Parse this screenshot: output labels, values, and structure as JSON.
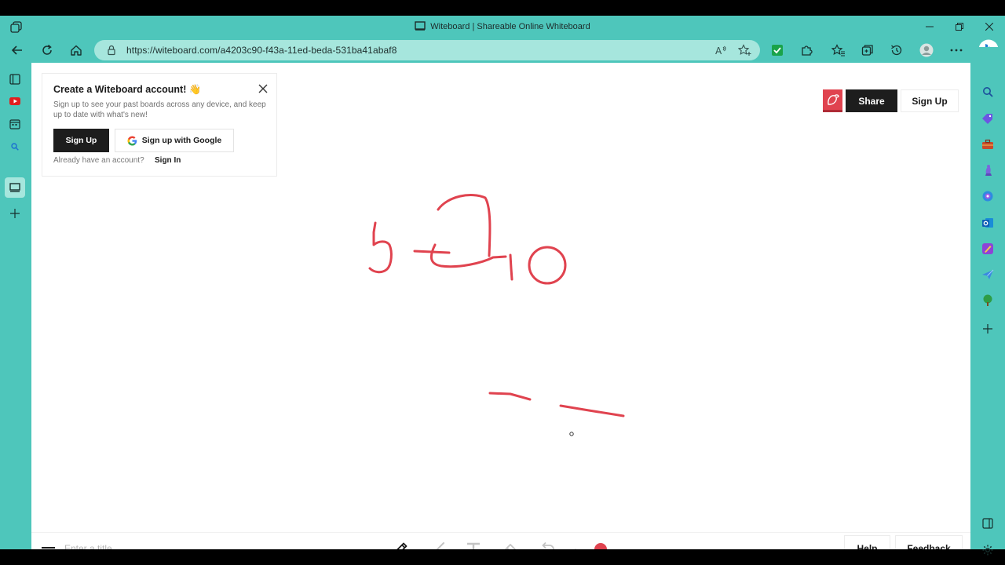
{
  "window": {
    "title": "Witeboard | Shareable Online Whiteboard"
  },
  "browser": {
    "url": "https://witeboard.com/a4203c90-f43a-11ed-beda-531ba41abaf8",
    "accent_color": "#4ec6bb",
    "address_bar_color": "#a6e6dd"
  },
  "left_sidebar": {
    "icons": [
      "tab-actions-icon",
      "youtube-icon",
      "calendar-icon",
      "search-icon",
      "whiteboard-icon",
      "add-icon"
    ]
  },
  "right_sidebar": {
    "icons": [
      "search-icon",
      "tag-icon",
      "briefcase-icon",
      "chess-icon",
      "copilot-icon",
      "outlook-icon",
      "designer-icon",
      "send-icon",
      "tree-icon",
      "add-icon",
      "panel-icon",
      "settings-icon"
    ]
  },
  "promo": {
    "title": "Create a Witeboard account! 👋",
    "description": "Sign up to see your past boards across any device, and keep up to date with what's new!",
    "signup_label": "Sign Up",
    "google_label": "Sign up with Google",
    "already_label": "Already have an account?",
    "signin_label": "Sign In"
  },
  "header": {
    "share_label": "Share",
    "signup_label": "Sign Up",
    "avatar_color": "#e0434f"
  },
  "canvas": {
    "stroke_color": "#e0434f"
  },
  "bottom_bar": {
    "title_placeholder": "Enter a title",
    "title_value": "",
    "tools": [
      "pen-icon",
      "line-icon",
      "text-icon",
      "eraser-icon",
      "undo-icon"
    ],
    "selected_tool": "pen-icon",
    "selected_color": "#e0434f",
    "help_label": "Help",
    "feedback_label": "Feedback"
  }
}
